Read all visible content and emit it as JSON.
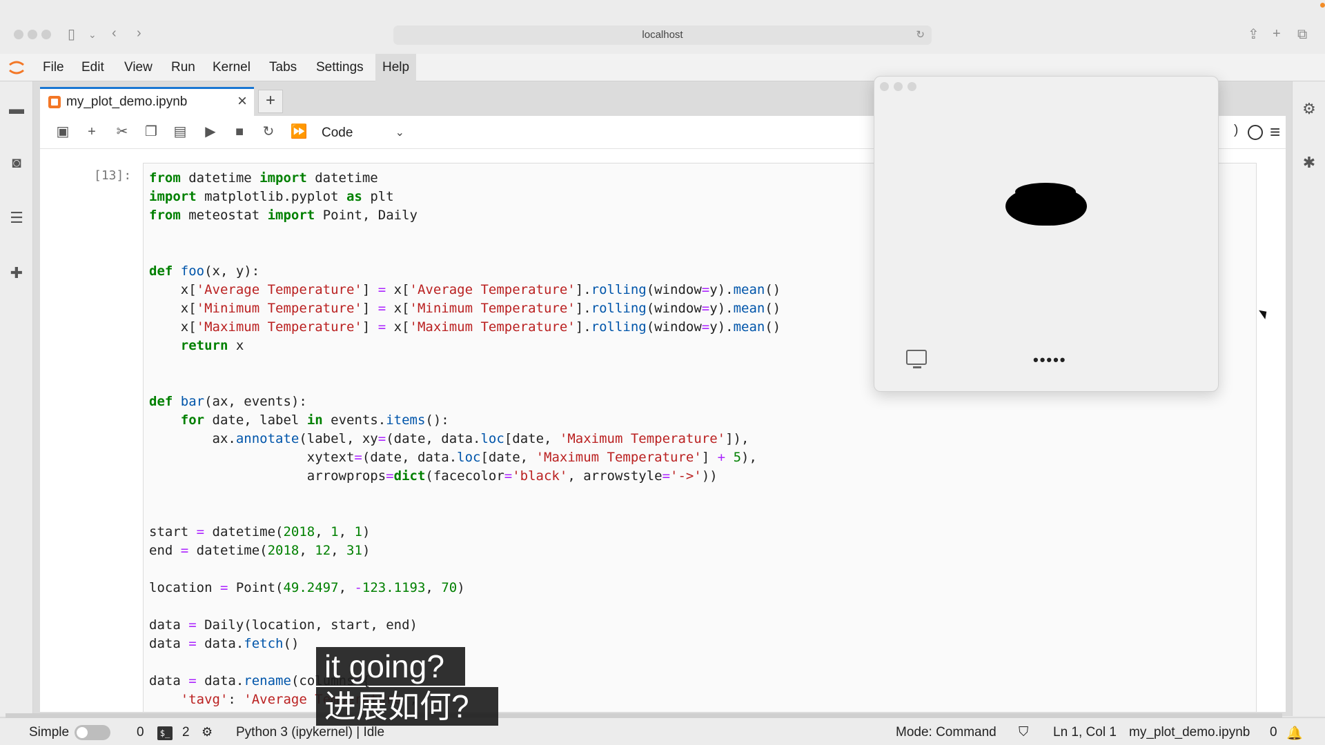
{
  "browser": {
    "url": "localhost"
  },
  "menu": {
    "items": [
      "File",
      "Edit",
      "View",
      "Run",
      "Kernel",
      "Tabs",
      "Settings",
      "Help"
    ]
  },
  "tabs": {
    "active_title": "my_plot_demo.ipynb",
    "close_glyph": "×",
    "add_glyph": "+"
  },
  "toolbar": {
    "cell_type": "Code",
    "kernel_indicator": ")"
  },
  "cell": {
    "prompt": "[13]:"
  },
  "floating_window": {
    "password_mask": "•••••"
  },
  "status": {
    "mode_label": "Simple",
    "terminals": "0",
    "kernels": "2",
    "kernel_name": "Python 3 (ipykernel) | Idle",
    "mode": "Mode: Command",
    "cursor_pos": "Ln 1, Col 1",
    "file": "my_plot_demo.ipynb",
    "notifications": "0"
  },
  "subtitles": {
    "line1": "it going?",
    "line2": "进展如何?"
  },
  "icons": {
    "save": "save-icon",
    "add": "plus-icon",
    "cut": "scissors-icon",
    "copy": "copy-icon",
    "paste": "paste-icon",
    "run": "play-icon",
    "stop": "stop-icon",
    "restart": "refresh-icon",
    "run_all": "fast-forward-icon"
  },
  "colors": {
    "accent": "#1976d2",
    "jupyter_orange": "#f37726",
    "keyword": "#008000",
    "string": "#ba2121",
    "function": "#0055aa"
  }
}
